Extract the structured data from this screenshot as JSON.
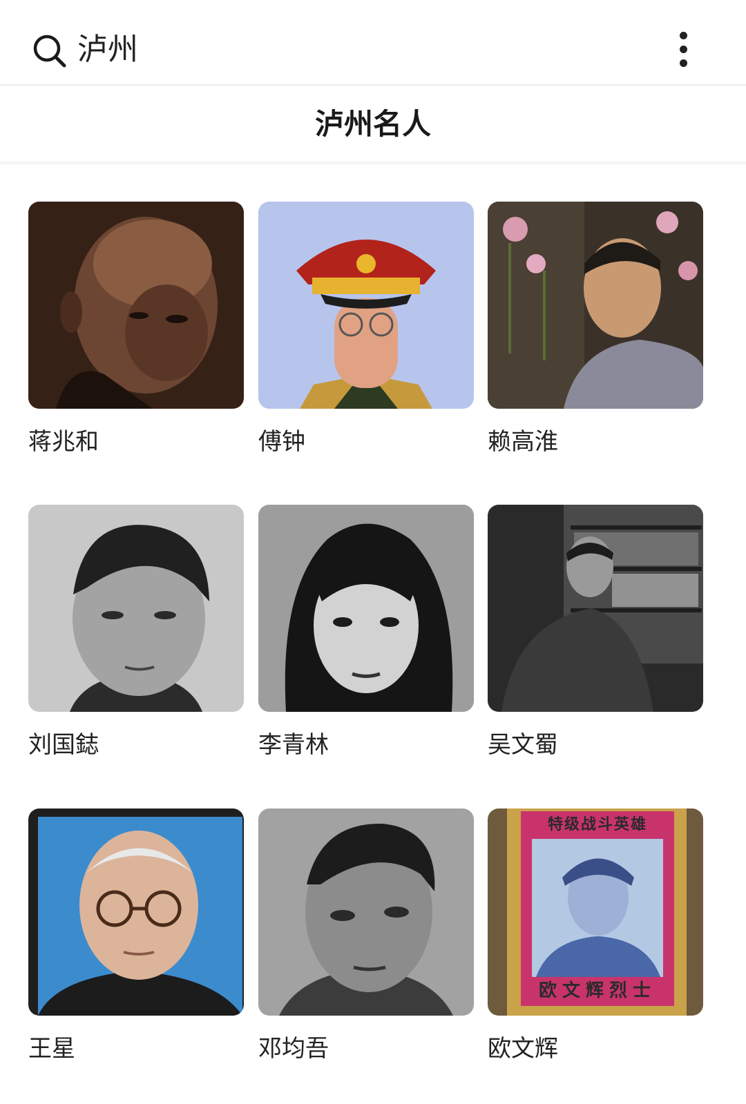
{
  "search": {
    "query": "泸州"
  },
  "page": {
    "title": "泸州名人"
  },
  "people": [
    {
      "name": "蒋兆和",
      "photo": "portrait-sepia-elderly-man"
    },
    {
      "name": "傅钟",
      "photo": "portrait-military-cap-glasses"
    },
    {
      "name": "赖高淮",
      "photo": "portrait-man-flowers"
    },
    {
      "name": "刘国鋕",
      "photo": "portrait-bw-young-man"
    },
    {
      "name": "李青林",
      "photo": "portrait-bw-woman"
    },
    {
      "name": "吴文蜀",
      "photo": "portrait-bw-man-bookshelf"
    },
    {
      "name": "王星",
      "photo": "portrait-glasses-blue-background"
    },
    {
      "name": "邓均吾",
      "photo": "portrait-bw-man"
    },
    {
      "name": "欧文辉",
      "photo": "framed-portrait-soldier"
    }
  ],
  "framed_portrait": {
    "banner": "特级战斗英雄",
    "caption": "欧文辉烈士"
  },
  "colors": {
    "background": "#ffffff",
    "text": "#222222",
    "divider": "#ececec"
  }
}
